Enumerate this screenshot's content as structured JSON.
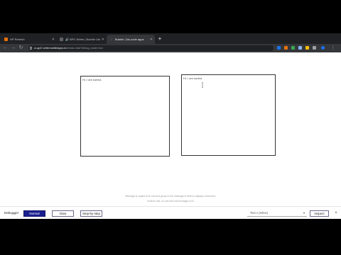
{
  "browser": {
    "tabs": [
      {
        "label": "HP Refresh",
        "favicon_color": "#e8710a",
        "active": false
      },
      {
        "label": "🔊 BPG Writer | Bubble Library",
        "favicon_color": "#5f6368",
        "active": false
      },
      {
        "label": "Bubble | No-code apps",
        "favicon_color": "#3d3d3d",
        "active": true
      }
    ],
    "new_tab_symbol": "+",
    "url_host": "w-qp47-writer.bubbleapps.io",
    "url_path": "/version-test/?debug_mode=true",
    "back_symbol": "←",
    "forward_symbol": "→",
    "reload_symbol": "↻",
    "tab_close_symbol": "✕",
    "extension_colors": [
      "#1a73e8",
      "#e8710a",
      "#34a853",
      "#8ab4f8",
      "#fbbc04",
      "#9aa0a6"
    ]
  },
  "page": {
    "left_box_text": "Hi, I am sorted.",
    "right_box_text": "Hi, I am sorted.",
    "hint_line_1": "Message is copied from one text group to the message in field on display a field next.",
    "hint_line_2": "It will be lost, no one else will message is #1"
  },
  "debugger": {
    "label": "Debugger",
    "normal_label": "Normal",
    "slow_label": "Slow",
    "step_label": "Step-by-step",
    "select_value": "Text A (Inline)",
    "inspect_label": "Inspect",
    "close_symbol": "×",
    "accent_color": "#1a1f8f"
  }
}
